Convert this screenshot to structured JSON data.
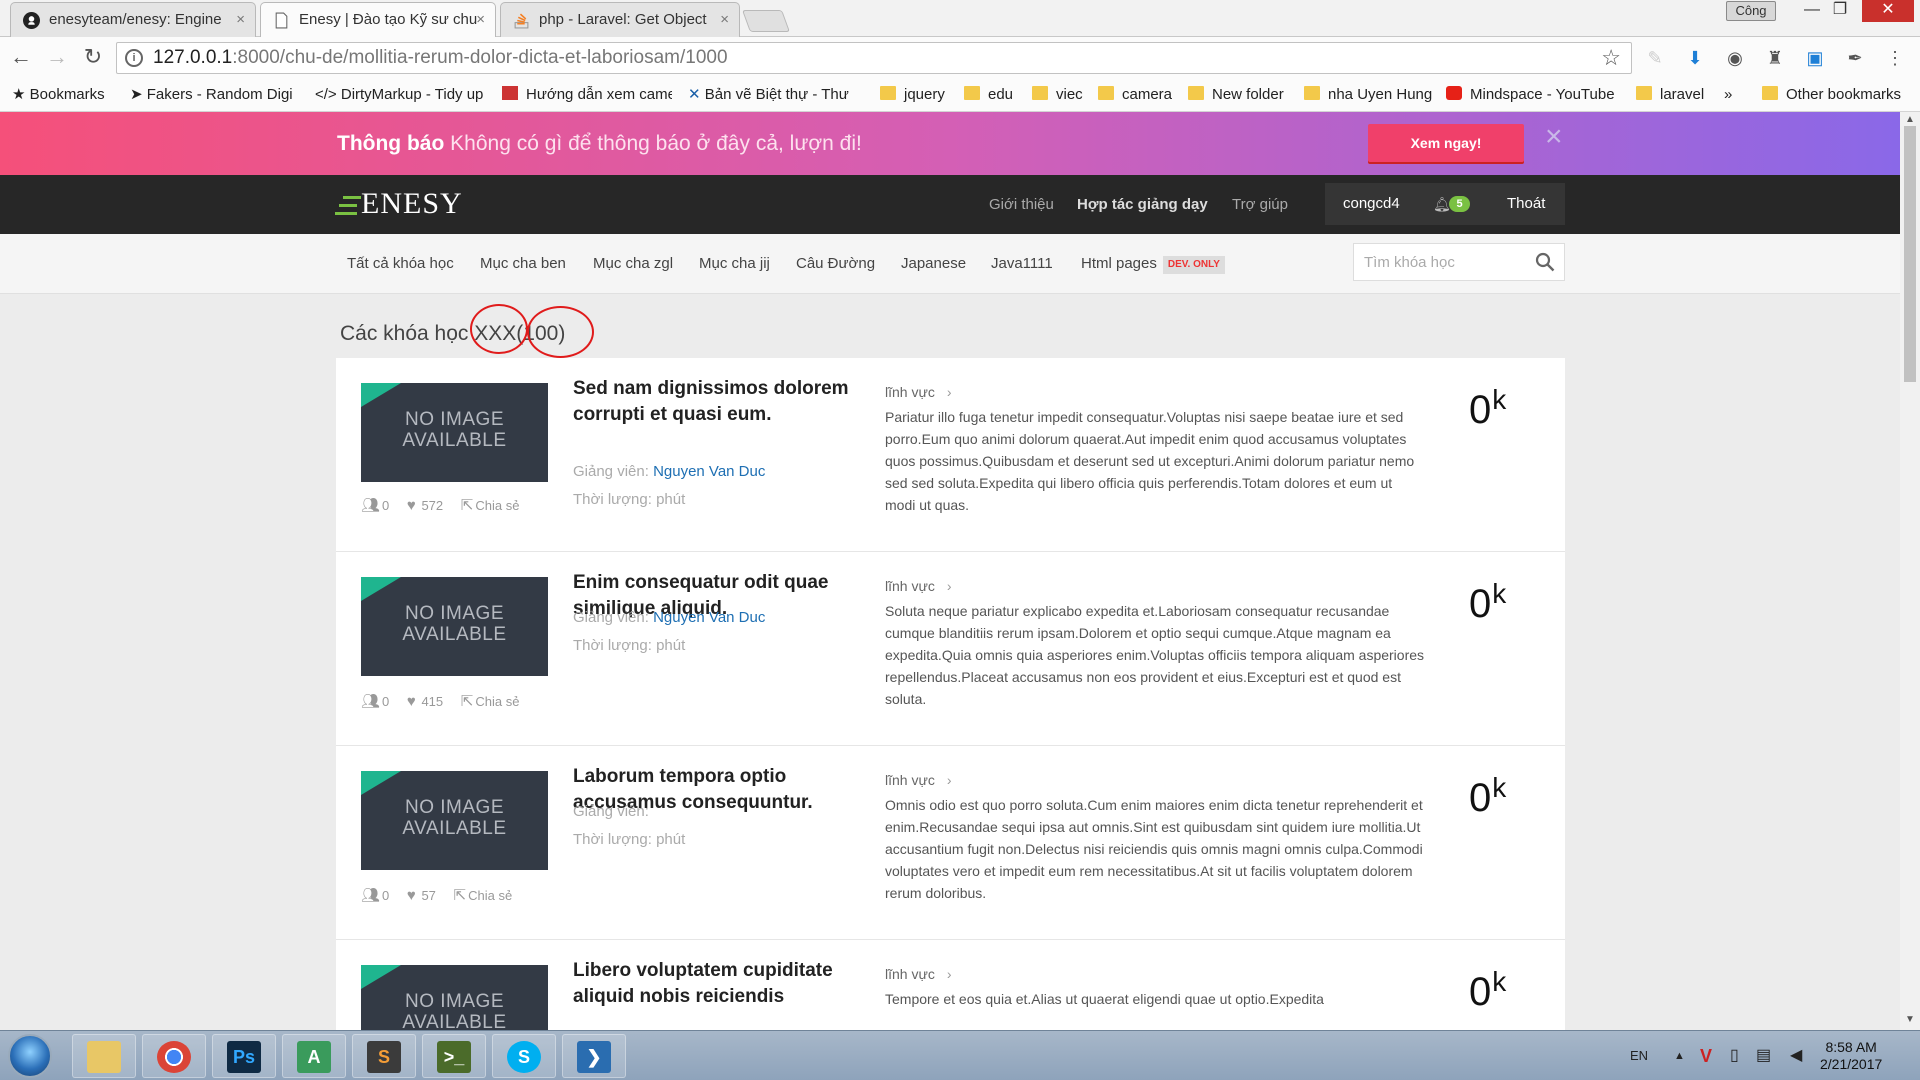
{
  "browser": {
    "tabs": [
      {
        "title": "enesyteam/enesy: Engine",
        "icon": "github-icon"
      },
      {
        "title": "Enesy | Đào tạo Kỹ sư chu",
        "icon": "page-icon"
      },
      {
        "title": "php - Laravel: Get Object",
        "icon": "stackoverflow-icon"
      }
    ],
    "tab_close": "×",
    "profile_label": "Công",
    "window_controls": {
      "minimize": "—",
      "restore": "❐",
      "close": "✕"
    },
    "nav": {
      "back": "←",
      "forward": "→",
      "reload": "↻"
    },
    "url_host": "127.0.0.1",
    "url_rest": ":8000/chu-de/mollitia-rerum-dolor-dicta-et-laboriosam/1000",
    "bookmark_star": "☆",
    "bookmarks": [
      "Bookmarks",
      "Fakers - Random Digi",
      "DirtyMarkup - Tidy up",
      "Hướng dẫn xem came",
      "Bản vẽ Biệt thự - Thư",
      "jquery",
      "edu",
      "viec",
      "camera",
      "New folder",
      "nha Uyen Hung",
      "Mindspace - YouTube",
      "laravel"
    ],
    "bookmarks_more": "»",
    "other_bookmarks": "Other bookmarks"
  },
  "notification": {
    "label": "Thông báo",
    "message": "Không có gì để thông báo ở đây cả, lượn đi!",
    "cta": "Xem ngay!",
    "close": "×"
  },
  "header": {
    "logo": "ENESY",
    "nav": [
      "Giới thiệu",
      "Hợp tác giảng dạy",
      "Trợ giúp"
    ],
    "username": "congcd4",
    "notif_count": "5",
    "logout": "Thoát"
  },
  "categories": [
    "Tất cả khóa học",
    "Mục cha ben",
    "Mục cha zgl",
    "Mục cha jij",
    "Câu Đường",
    "Japanese",
    "Java1111",
    "Html pages"
  ],
  "dev_badge": "DEV. ONLY",
  "search_placeholder": "Tìm khóa học",
  "page": {
    "title_prefix": "Các khóa học",
    "title_name": "XXX",
    "title_count": "(100)"
  },
  "labels": {
    "no_image_1": "NO IMAGE",
    "no_image_2": "AVAILABLE",
    "instructor": "Giảng viên:",
    "duration": "Thời lượng: phút",
    "field": "lĩnh vực",
    "share": "Chia sẻ"
  },
  "courses": [
    {
      "title": "Sed nam dignissimos dolorem corrupti et quasi eum.",
      "instructor": "Nguyen Van Duc",
      "students": "0",
      "likes": "572",
      "description": "Pariatur illo fuga tenetur impedit consequatur.Voluptas nisi saepe beatae iure et sed porro.Eum quo animi dolorum quaerat.Aut impedit enim quod accusamus voluptates quos possimus.Quibusdam et deserunt sed ut excepturi.Animi dolorum pariatur nemo sed sed soluta.Expedita qui libero officia quis perferendis.Totam dolores et eum ut modi ut quas.",
      "price": "0",
      "price_unit": "k"
    },
    {
      "title": "Enim consequatur odit quae similique aliquid.",
      "instructor": "Nguyen Van Duc",
      "students": "0",
      "likes": "415",
      "description": "Soluta neque pariatur explicabo expedita et.Laboriosam consequatur recusandae cumque blanditiis rerum ipsam.Dolorem et optio sequi cumque.Atque magnam ea expedita.Quia omnis quia asperiores enim.Voluptas officiis tempora aliquam asperiores repellendus.Placeat accusamus non eos provident et eius.Excepturi est et quod est soluta.",
      "price": "0",
      "price_unit": "k"
    },
    {
      "title": "Laborum tempora optio accusamus consequuntur.",
      "instructor": "",
      "students": "0",
      "likes": "57",
      "description": "Omnis odio est quo porro soluta.Cum enim maiores enim dicta tenetur reprehenderit et enim.Recusandae sequi ipsa aut omnis.Sint est quibusdam sint quidem iure mollitia.Ut accusantium fugit non.Delectus nisi reiciendis quis omnis magni omnis culpa.Commodi voluptates vero et impedit eum rem necessitatibus.At sit ut facilis voluptatem dolorem rerum doloribus.",
      "price": "0",
      "price_unit": "k"
    },
    {
      "title": "Libero voluptatem cupiditate aliquid nobis reiciendis",
      "instructor": "",
      "students": "",
      "likes": "",
      "description": "Tempore et eos quia et.Alias ut quaerat eligendi quae ut optio.Expedita",
      "price": "0",
      "price_unit": "k"
    }
  ],
  "taskbar": {
    "apps": [
      "Windows Explorer",
      "Google Chrome",
      "Ps",
      "A",
      "S",
      "Terminal",
      "Skype",
      "PowerShell"
    ],
    "lang": "EN",
    "time": "8:58 AM",
    "date": "2/21/2017"
  }
}
